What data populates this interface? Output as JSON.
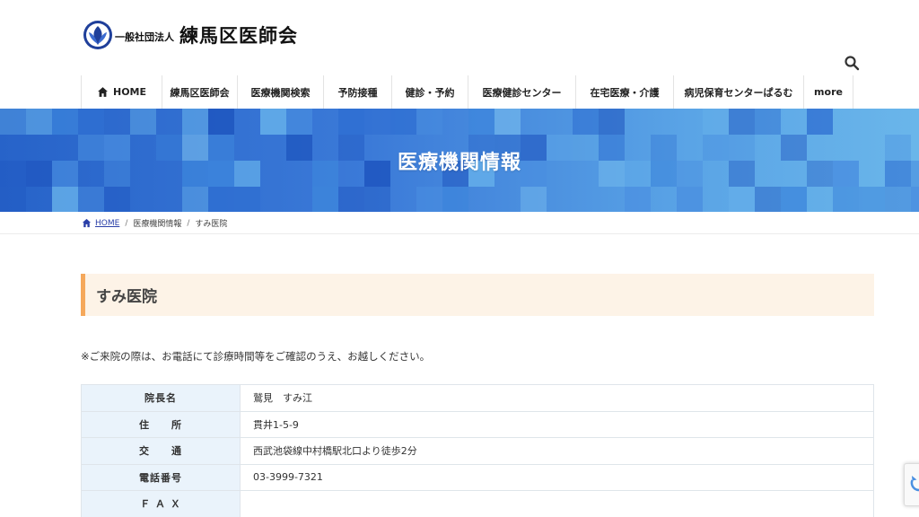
{
  "header": {
    "logo_sub": "一般社団法人",
    "logo_main": "練馬区医師会",
    "nav": [
      {
        "label": "HOME",
        "icon": "home-icon",
        "width": 90
      },
      {
        "label": "練馬区医師会",
        "width": 84
      },
      {
        "label": "医療機関検索",
        "width": 96
      },
      {
        "label": "予防接種",
        "width": 76
      },
      {
        "label": "健診・予約",
        "width": 85
      },
      {
        "label": "医療健診センター",
        "width": 120
      },
      {
        "label": "在宅医療・介護",
        "width": 109
      },
      {
        "label": "病児保育センターぱるむ",
        "width": 145
      },
      {
        "label": "more",
        "width": 56
      }
    ]
  },
  "banner": {
    "title": "医療機関情報"
  },
  "breadcrumb": {
    "home": "HOME",
    "parent": "医療機関情報",
    "current": "すみ医院"
  },
  "page": {
    "title": "すみ医院",
    "notice": "※ご来院の際は、お電話にて診療時間等をご確認のうえ、お越しください。"
  },
  "info_rows": [
    {
      "label": "院長名",
      "value": "鷲見　すみ江"
    },
    {
      "label": "住　　所",
      "value": "貫井1-5-9"
    },
    {
      "label": "交　　通",
      "value": "西武池袋線中村橋駅北口より徒歩2分"
    },
    {
      "label": "電話番号",
      "value": "03-3999-7321"
    },
    {
      "label": "Ｆ Ａ Ｘ",
      "value": ""
    }
  ],
  "colors": {
    "accent": "#f5a85b",
    "heading_bg": "#fdf3e7",
    "banner_blue": "#2763c9",
    "table_header_bg": "#eaf3fb",
    "link": "#2a3fa8"
  }
}
